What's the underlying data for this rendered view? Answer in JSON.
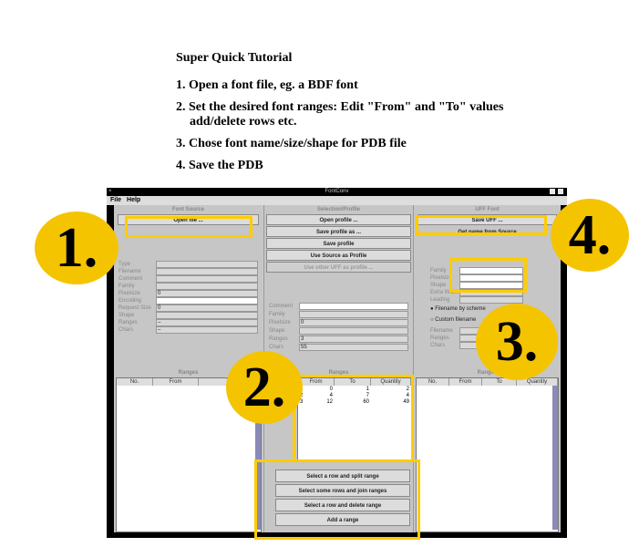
{
  "tutorial": {
    "title": "Super Quick Tutorial",
    "steps": [
      {
        "text": "1. Open a font file, eg. a BDF font",
        "sub": ""
      },
      {
        "text": "2. Set the desired font ranges: Edit \"From\" and \"To\" values",
        "sub": "add/delete rows etc."
      },
      {
        "text": "3. Chose font name/size/shape for PDB file",
        "sub": ""
      },
      {
        "text": "4. Save the PDB",
        "sub": ""
      }
    ]
  },
  "window": {
    "title": "FontConv",
    "close_glyph": "×",
    "menu": [
      "File",
      "Help"
    ]
  },
  "font_source": {
    "header": "Font Source",
    "open_button": "Open file ...",
    "labels": [
      "Type",
      "Filename",
      "Comment",
      "Family",
      "Pixelsize",
      "Encoding",
      "Request Size",
      "Shape",
      "Ranges",
      "Chars"
    ],
    "values": [
      "",
      "",
      "",
      "",
      "0",
      "",
      "0",
      "",
      "–",
      "–"
    ],
    "ranges_label": "Ranges",
    "columns": [
      "No.",
      "From",
      "To"
    ]
  },
  "profile": {
    "header": "Selection/Profile",
    "buttons": [
      "Open profile ...",
      "Save profile as ...",
      "Save profile",
      "Use Source as Profile"
    ],
    "disabled_button": "Use other UFF as profile ...",
    "labels": [
      "Comment",
      "Family",
      "Pixelsize",
      "Shape",
      "Ranges",
      "Chars"
    ],
    "values": [
      "",
      "",
      "0",
      "",
      "3",
      "55"
    ],
    "ranges_label": "Ranges",
    "columns": [
      "From",
      "To",
      "Quantity"
    ],
    "rows": [
      {
        "no": "1",
        "from": "0",
        "to": "1",
        "qty": "2"
      },
      {
        "no": "2",
        "from": "4",
        "to": "7",
        "qty": "4"
      },
      {
        "no": "3",
        "from": "12",
        "to": "60",
        "qty": "49"
      }
    ],
    "actions": [
      "Select a row and split range",
      "Select some rows and join ranges",
      "Select a row and delete range",
      "Add a range"
    ]
  },
  "uff": {
    "header": "UFF Font",
    "save_button": "Save UFF ...",
    "name_button": "Get name from Source",
    "labels": [
      "Family",
      "Pixelsize",
      "Shape",
      "Extra Width",
      "Leading"
    ],
    "radio_scheme": "Filename by scheme",
    "radio_custom": "Custom filename",
    "labels2": [
      "Filename",
      "Ranges",
      "Chars"
    ],
    "ranges_label": "Ranges",
    "columns": [
      "No.",
      "From",
      "To",
      "Quantity"
    ]
  },
  "badges": [
    "1.",
    "2.",
    "3.",
    "4."
  ],
  "colors": {
    "highlight": "#ffcc00",
    "badge": "#f5c400",
    "scrollbar": "#8a8ab8"
  }
}
